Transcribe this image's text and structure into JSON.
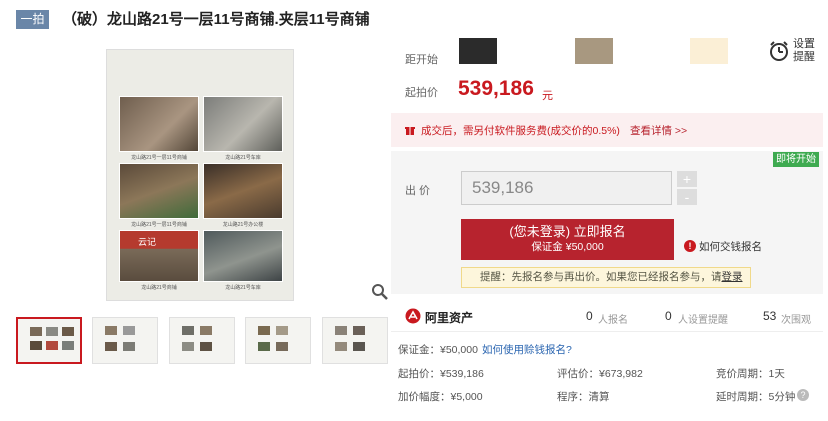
{
  "header": {
    "badge": "一拍",
    "title": "（破）龙山路21号一层11号商铺.夹层11号商铺"
  },
  "gallery": {
    "captions": [
      "龙山路21号一层11号商铺",
      "龙山路21号车库",
      "龙山路21号一层11号商铺",
      "龙山路21号办公楼",
      "龙山路21号商铺",
      "龙山路21号车库"
    ],
    "sign_text": "云记"
  },
  "auction": {
    "countdown_label": "距开始",
    "reminder_label": "设置提醒",
    "start_price_label": "起拍价",
    "start_price": "539,186",
    "currency_unit": "元",
    "fee_notice": "成交后，需另付软件服务费(成交价的0.5%)",
    "fee_details_link": "查看详情 >>",
    "status_tag": "即将开始",
    "bid_label": "出 价",
    "bid_value": "539,186",
    "plus": "+",
    "minus": "-",
    "signup_main": "(您未登录) 立即报名",
    "signup_sub": "保证金 ¥50,000",
    "how_to_pay": "如何交钱报名",
    "tip_text": "提醒：先报名参与再出价。如果您已经报名参与，请",
    "tip_login": "登录"
  },
  "stats": {
    "platform": "阿里资产",
    "signups_count": "0",
    "signups_label": "人报名",
    "reminders_count": "0",
    "reminders_label": "人设置提醒",
    "views_count": "53",
    "views_label": "次围观"
  },
  "details": {
    "deposit_label": "保证金：",
    "deposit_value": "¥50,000",
    "loan_link": "如何使用赊钱报名?",
    "start_label": "起拍价：",
    "start_value": "¥539,186",
    "eval_label": "评估价：",
    "eval_value": "¥673,982",
    "cycle_label": "竞价周期：",
    "cycle_value": "1天",
    "increment_label": "加价幅度：",
    "increment_value": "¥5,000",
    "procedure_label": "程序：",
    "procedure_value": "清算",
    "delay_label": "延时周期：",
    "delay_value": "5分钟"
  },
  "colors": {
    "accent": "#c9191f",
    "button": "#b7232e",
    "badge": "#6a86a8",
    "status_green": "#3eaa50"
  }
}
